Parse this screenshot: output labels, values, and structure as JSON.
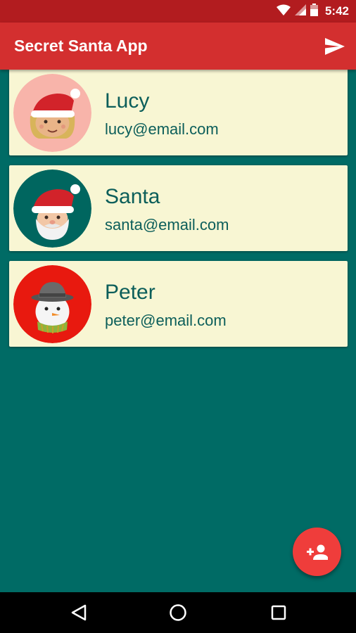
{
  "status_bar": {
    "time": "5:42",
    "icons": [
      "wifi-icon",
      "cell-signal-icon",
      "battery-icon"
    ]
  },
  "app_bar": {
    "title": "Secret Santa App",
    "action_icon": "send-icon"
  },
  "participants": [
    {
      "name": "Lucy",
      "email": "lucy@email.com",
      "avatar": "girl-santa-hat-avatar",
      "avatar_bg": "#f8b4aa"
    },
    {
      "name": "Santa",
      "email": "santa@email.com",
      "avatar": "santa-avatar",
      "avatar_bg": "#00665f"
    },
    {
      "name": "Peter",
      "email": "peter@email.com",
      "avatar": "snowman-avatar",
      "avatar_bg": "#e8190f"
    }
  ],
  "fab": {
    "icon": "add-person-icon"
  },
  "navigation": {
    "icons": [
      "back-icon",
      "home-icon",
      "recents-icon"
    ]
  },
  "colors": {
    "status_bar": "#b21c1f",
    "app_bar": "#d32f2f",
    "background": "#006b65",
    "card": "#f8f6d3",
    "text": "#0c5e5a",
    "fab": "#ef3d3b"
  }
}
